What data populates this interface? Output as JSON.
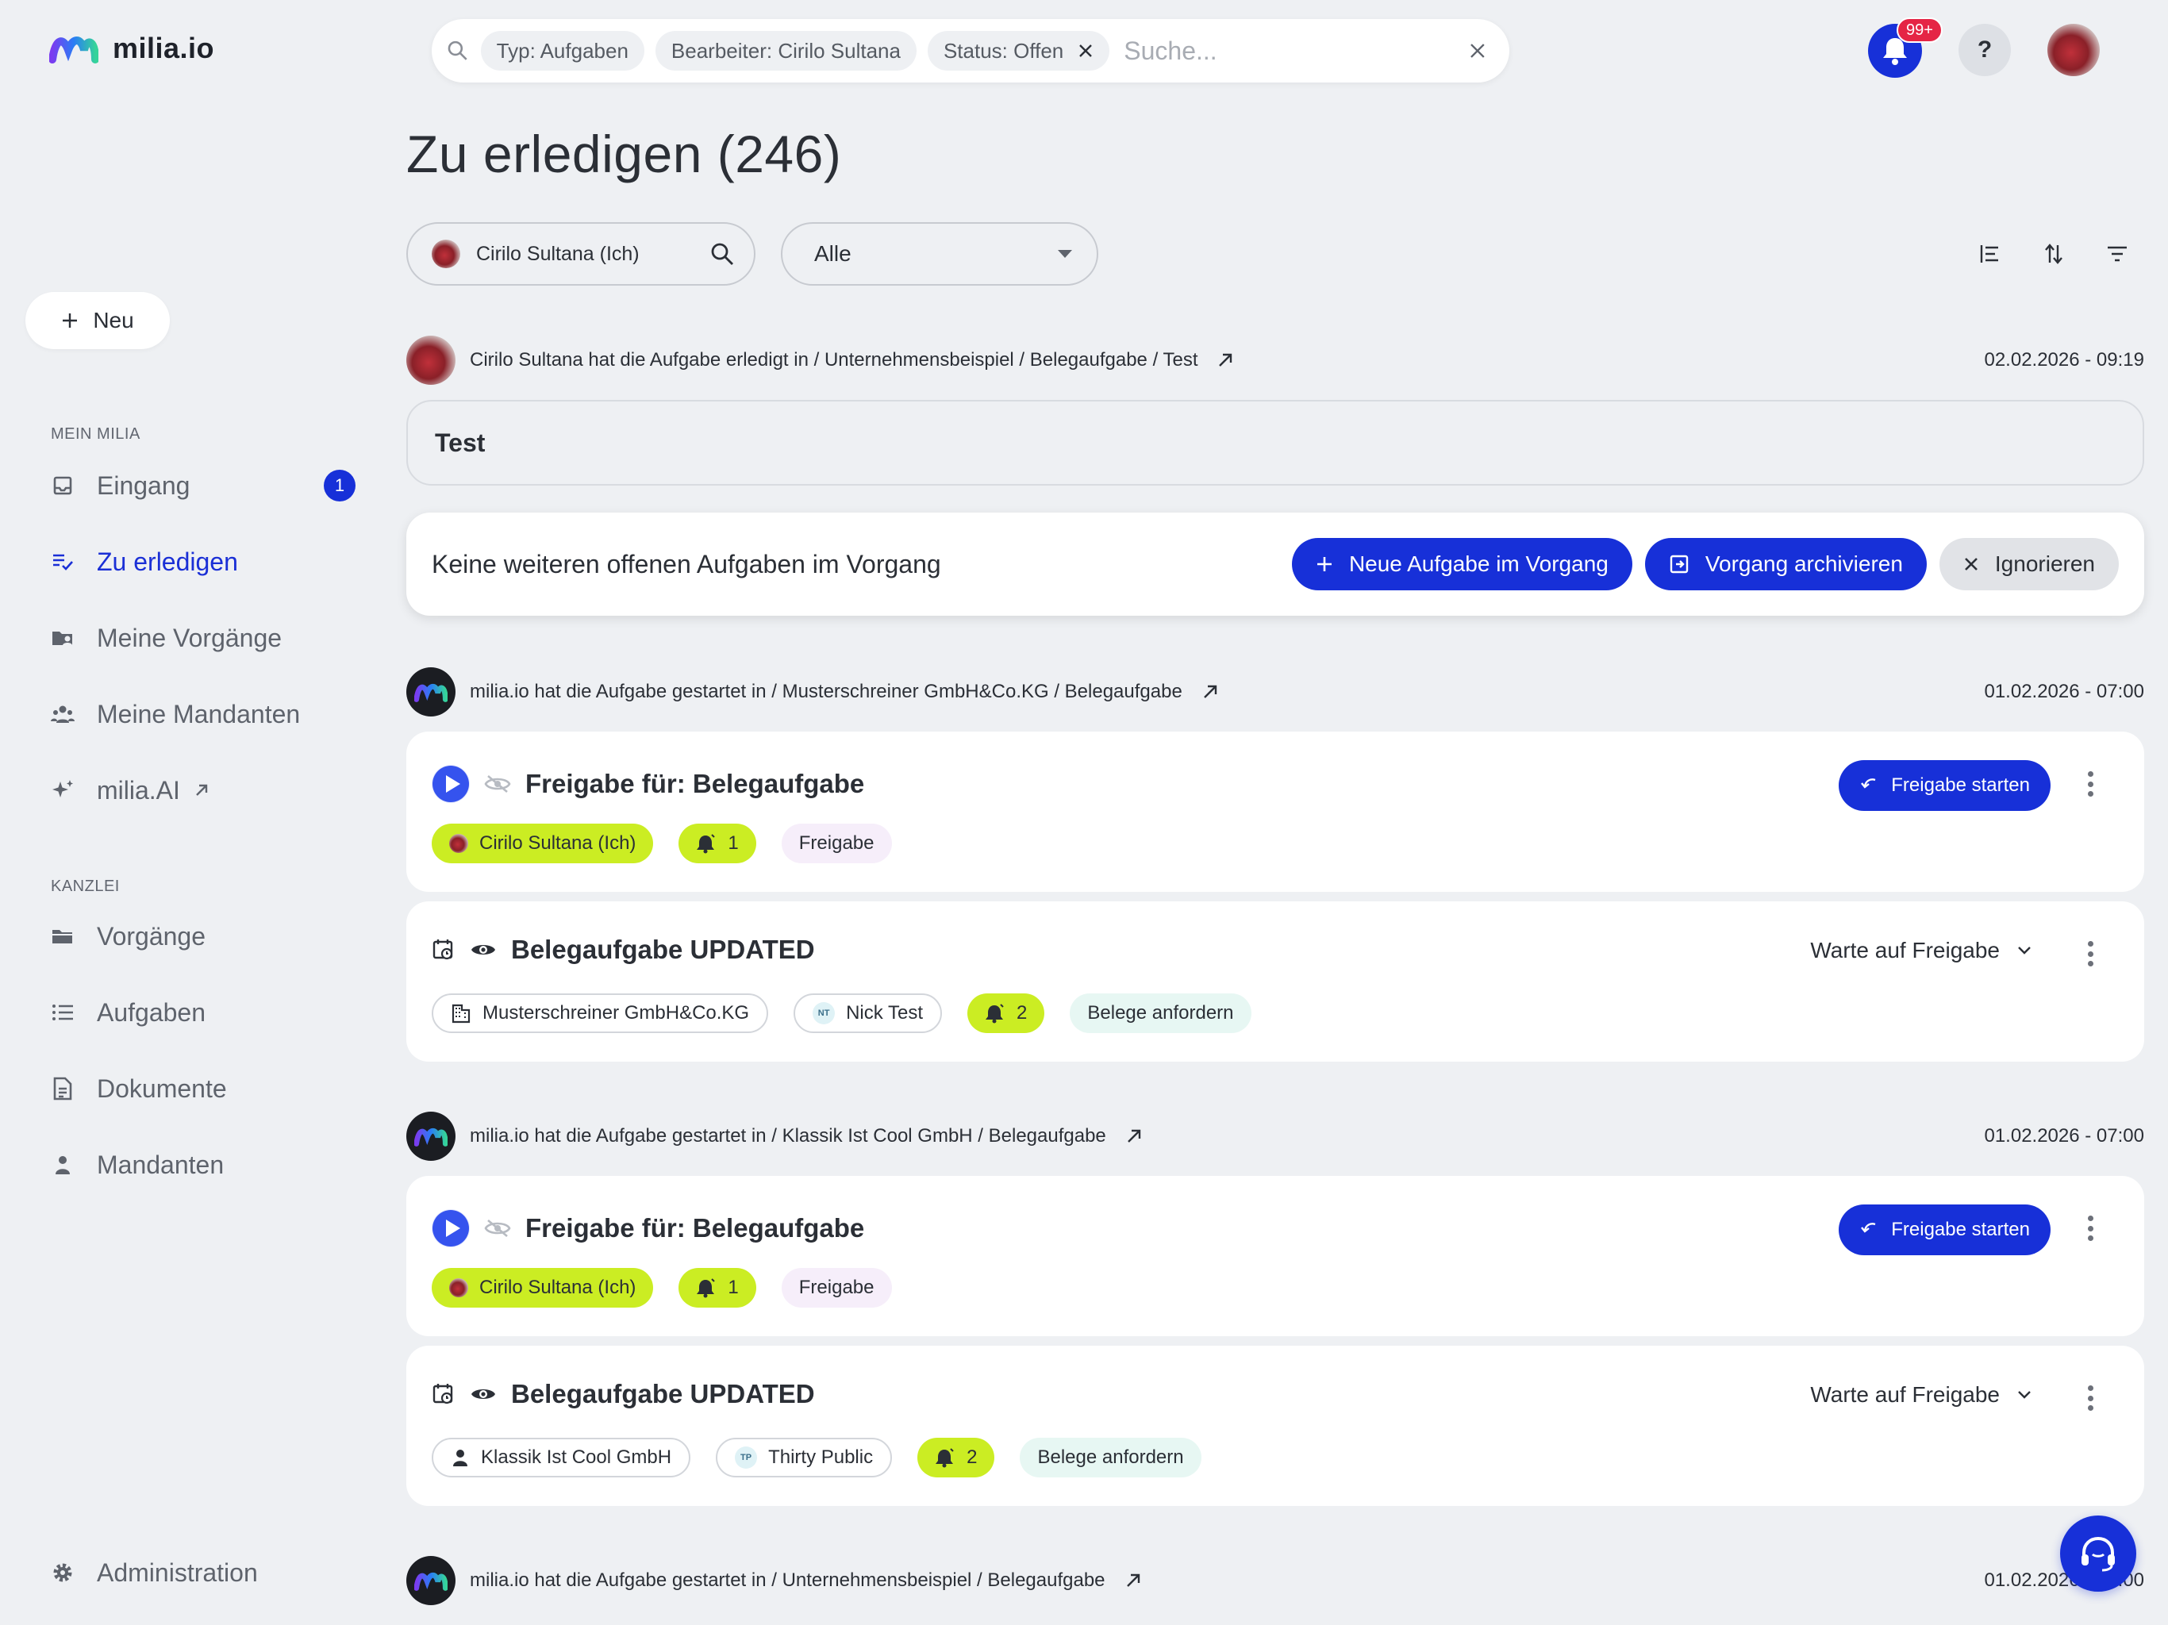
{
  "brand": {
    "name": "milia.io"
  },
  "sidebar": {
    "new_button": "Neu",
    "section_mein": "MEIN MILIA",
    "section_kanzlei": "KANZLEI",
    "items_mein": [
      {
        "label": "Eingang",
        "icon": "inbox-icon",
        "badge": "1"
      },
      {
        "label": "Zu erledigen",
        "icon": "todo-list-icon",
        "active": true
      },
      {
        "label": "Meine Vorgänge",
        "icon": "folder-user-icon"
      },
      {
        "label": "Meine Mandanten",
        "icon": "clients-icon"
      },
      {
        "label": "milia.AI",
        "icon": "sparkle-icon",
        "external": true
      }
    ],
    "items_kanzlei": [
      {
        "label": "Vorgänge",
        "icon": "folder-icon"
      },
      {
        "label": "Aufgaben",
        "icon": "list-icon"
      },
      {
        "label": "Dokumente",
        "icon": "document-icon"
      },
      {
        "label": "Mandanten",
        "icon": "person-icon"
      }
    ],
    "admin": "Administration"
  },
  "search": {
    "chips": [
      "Typ: Aufgaben",
      "Bearbeiter: Cirilo Sultana",
      "Status: Offen"
    ],
    "placeholder": "Suche..."
  },
  "topbar": {
    "notifications_badge": "99+",
    "help": "?"
  },
  "page": {
    "title": "Zu erledigen (246)",
    "person_filter": "Cirilo Sultana (Ich)",
    "select_value": "Alle"
  },
  "activity1": {
    "text": "Cirilo Sultana hat die Aufgabe erledigt in / Unternehmensbeispiel / Belegaufgabe / Test",
    "date": "02.02.2026 - 09:19",
    "card_text": "Test"
  },
  "banner": {
    "text": "Keine weiteren offenen Aufgaben im Vorgang",
    "btn_new": "Neue Aufgabe im Vorgang",
    "btn_archive": "Vorgang archivieren",
    "btn_ignore": "Ignorieren"
  },
  "activity2": {
    "text": "milia.io hat die Aufgabe gestartet in / Musterschreiner GmbH&Co.KG / Belegaufgabe",
    "date": "01.02.2026 - 07:00",
    "task1": {
      "title": "Freigabe für: Belegaufgabe",
      "assignee": "Cirilo Sultana (Ich)",
      "count": "1",
      "type": "Freigabe",
      "action": "Freigabe starten"
    },
    "task2": {
      "title": "Belegaufgabe UPDATED",
      "client": "Musterschreiner GmbH&Co.KG",
      "person": "Nick Test",
      "person_initials": "NT",
      "count": "2",
      "type": "Belege anfordern",
      "status": "Warte auf Freigabe"
    }
  },
  "activity3": {
    "text": "milia.io hat die Aufgabe gestartet in / Klassik Ist Cool GmbH / Belegaufgabe",
    "date": "01.02.2026 - 07:00",
    "task1": {
      "title": "Freigabe für: Belegaufgabe",
      "assignee": "Cirilo Sultana (Ich)",
      "count": "1",
      "type": "Freigabe",
      "action": "Freigabe starten"
    },
    "task2": {
      "title": "Belegaufgabe UPDATED",
      "client": "Klassik Ist Cool GmbH",
      "person": "Thirty Public",
      "person_initials": "TP",
      "count": "2",
      "type": "Belege anfordern",
      "status": "Warte auf Freigabe"
    }
  },
  "activity4": {
    "text": "milia.io hat die Aufgabe gestartet in / Unternehmensbeispiel / Belegaufgabe",
    "date": "01.02.2026 - 07:00"
  },
  "colors": {
    "primary": "#1730d8",
    "lime": "#cbed23",
    "background": "#eef0f3"
  }
}
